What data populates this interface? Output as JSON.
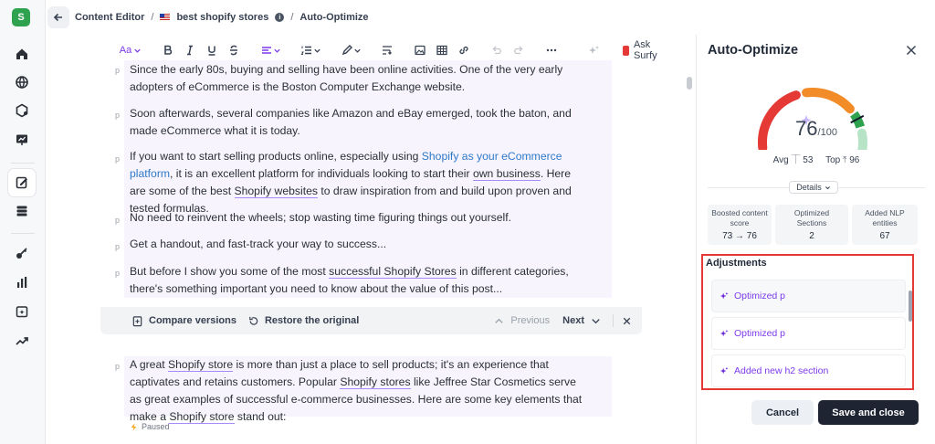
{
  "app": {
    "logo_letter": "S"
  },
  "header": {
    "crumb_root": "Content Editor",
    "crumb_doc": "best shopify stores",
    "crumb_page": "Auto-Optimize"
  },
  "toolbar": {
    "text_style": "Aa",
    "ask_label": "Ask Surfy"
  },
  "editor": {
    "para_label": "p",
    "paragraphs": [
      "Since the early 80s, buying and selling have been online activities. One of the very early adopters of eCommerce is the Boston Computer Exchange website.",
      "Soon afterwards, several companies like Amazon and eBay emerged, took the baton, and made eCommerce what it is today.",
      "No need to reinvent the wheels; stop wasting time figuring things out yourself.",
      "Get a handout, and fast-track your way to success..."
    ],
    "p3": {
      "a": "If you want to start selling products online, especially using ",
      "link": "Shopify as your eCommerce platform",
      "b": ", it is an excellent platform for individuals looking to start their ",
      "u1": "own business",
      "c": ". Here are some of the best ",
      "u2": "Shopify websites",
      "d": " to draw inspiration from and build upon proven and tested formulas."
    },
    "p6": {
      "a": "But before I show you some of the most ",
      "u1": "successful Shopify Stores",
      "b": " in different categories, there's something important you need to know about the value of this post..."
    },
    "p7": {
      "a": "A great ",
      "u1": "Shopify store",
      "b": " is more than just a place to sell products; it's an experience that captivates and retains customers. Popular ",
      "u2": "Shopify stores",
      "c": " like Jeffree Star Cosmetics serve as great examples of successful e-commerce businesses. Here are some key elements that make a ",
      "u3": "Shopify store",
      "d": " stand out:"
    },
    "compare_versions": "Compare versions",
    "restore_original": "Restore the original",
    "previous": "Previous",
    "next": "Next",
    "paused": "Paused"
  },
  "panel": {
    "title": "Auto-Optimize",
    "score": "76",
    "score_max": "/100",
    "score_value": 76,
    "avg_label": "Avg",
    "avg_value": "53",
    "top_label": "Top",
    "top_value": "96",
    "details": "Details",
    "stats": [
      {
        "label": "Boosted content score",
        "value": "73 → 76"
      },
      {
        "label": "Optimized Sections",
        "value": "2"
      },
      {
        "label": "Added NLP entities",
        "value": "67"
      }
    ],
    "adjustments_title": "Adjustments",
    "adjustments": [
      "Optimized p",
      "Optimized p",
      "Added new h2 section"
    ],
    "cancel": "Cancel",
    "save": "Save and close"
  },
  "colors": {
    "accent": "#7c3aed",
    "gauge_red": "#e53935",
    "gauge_orange": "#f28c28",
    "gauge_green": "#2fa24f",
    "gauge_light": "#b7e4c7",
    "highlight_border": "#e53935"
  }
}
